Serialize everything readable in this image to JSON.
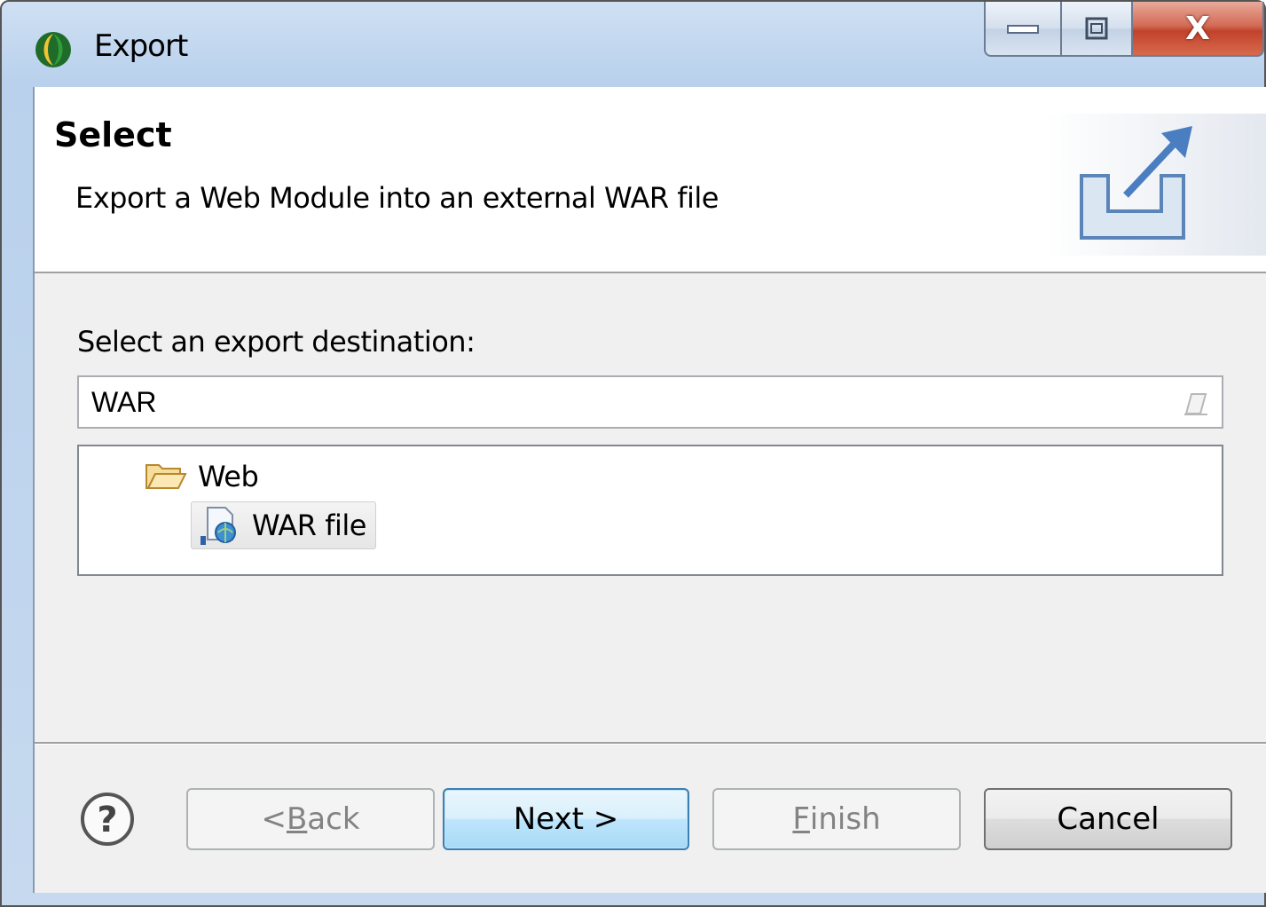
{
  "window": {
    "title": "Export",
    "close_glyph": "X"
  },
  "header": {
    "title": "Select",
    "description": "Export a Web Module into an external WAR file",
    "icon": "export-arrow-icon"
  },
  "main": {
    "destination_label": "Select an export destination:",
    "filter": {
      "value": "WAR"
    },
    "tree": [
      {
        "label": "Web",
        "icon": "folder-open-icon",
        "expanded": true,
        "children": [
          {
            "label": "WAR file",
            "icon": "war-file-icon",
            "selected": true
          }
        ]
      }
    ]
  },
  "buttons": {
    "back": {
      "prefix": "< ",
      "mnemonic": "B",
      "rest": "ack",
      "enabled": false
    },
    "next": {
      "label": "Next >",
      "enabled": true
    },
    "finish": {
      "mnemonic": "F",
      "rest": "inish",
      "enabled": false
    },
    "cancel": {
      "label": "Cancel",
      "enabled": true
    }
  },
  "colors": {
    "default_button_border": "#3c7fb1",
    "disabled_text": "#838383"
  }
}
